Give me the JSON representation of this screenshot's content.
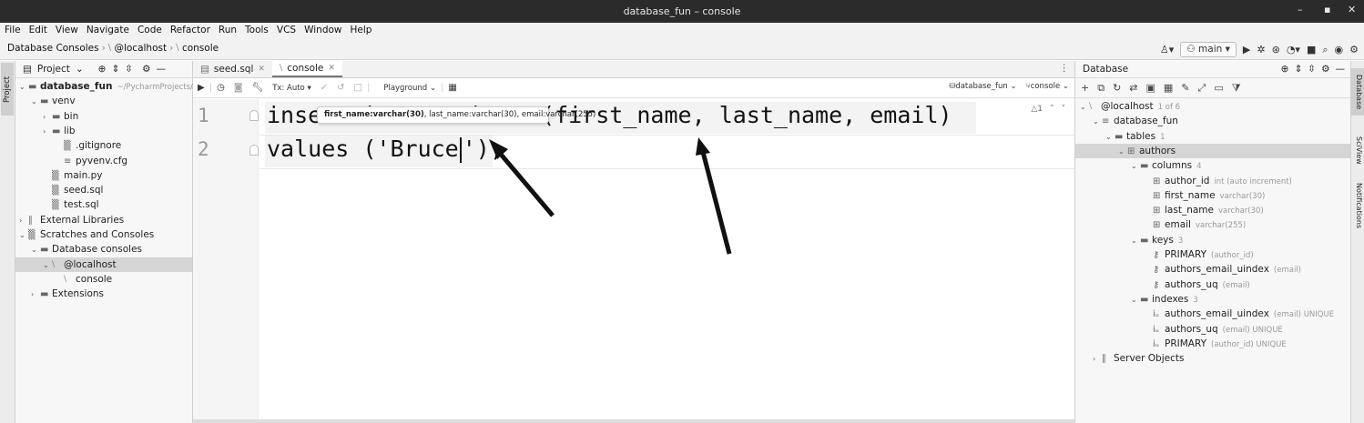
{
  "window": {
    "title": "database_fun – console",
    "min": "–",
    "restore": "▪",
    "close": "✕"
  },
  "menu": [
    "File",
    "Edit",
    "View",
    "Navigate",
    "Code",
    "Refactor",
    "Run",
    "Tools",
    "VCS",
    "Window",
    "Help"
  ],
  "breadcrumbs": [
    "Database Consoles",
    "@localhost",
    "console"
  ],
  "navbar": {
    "branch": "main"
  },
  "left_strip": {
    "project_tab": "Project"
  },
  "project_panel": {
    "title": "Project"
  },
  "project_tree": [
    {
      "label": "database_fun",
      "hint": "~/PycharmProjects/",
      "arrow": "⌄",
      "icon": "▬",
      "level": 0,
      "bold": true
    },
    {
      "label": "venv",
      "arrow": "⌄",
      "icon": "▬",
      "level": 1
    },
    {
      "label": "bin",
      "arrow": "›",
      "icon": "▬",
      "level": 2
    },
    {
      "label": "lib",
      "arrow": "›",
      "icon": "▬",
      "level": 2
    },
    {
      "label": ".gitignore",
      "arrow": "",
      "icon": "▒",
      "level": 3
    },
    {
      "label": "pyvenv.cfg",
      "arrow": "",
      "icon": "≡",
      "level": 3
    },
    {
      "label": "main.py",
      "arrow": "",
      "icon": "▒",
      "level": 2
    },
    {
      "label": "seed.sql",
      "arrow": "",
      "icon": "▒",
      "level": 2
    },
    {
      "label": "test.sql",
      "arrow": "",
      "icon": "▒",
      "level": 2
    },
    {
      "label": "External Libraries",
      "arrow": "›",
      "icon": "∥",
      "level": 0
    },
    {
      "label": "Scratches and Consoles",
      "arrow": "⌄",
      "icon": "▒",
      "level": 0
    },
    {
      "label": "Database consoles",
      "arrow": "⌄",
      "icon": "▬",
      "level": 1
    },
    {
      "label": "@localhost",
      "arrow": "⌄",
      "icon": "⧵",
      "level": 2,
      "selected": true
    },
    {
      "label": "console",
      "arrow": "",
      "icon": "⧵",
      "level": 3
    },
    {
      "label": "Extensions",
      "arrow": "›",
      "icon": "▬",
      "level": 1
    }
  ],
  "tabs": [
    {
      "label": "seed.sql",
      "close": "✕"
    },
    {
      "label": "console",
      "close": "✕"
    }
  ],
  "editor_toolbar": {
    "tx": "Tx: Auto",
    "playground": "Playground",
    "datasource": "database_fun",
    "session": "console"
  },
  "editor": {
    "line_numbers": [
      "1",
      "2"
    ],
    "line1": "insert into authors (first_name, last_name, email)",
    "line2_before_caret": "values ('Bruce",
    "line2_after_caret": "'),",
    "popup": {
      "bold": "first_name:varchar(30)",
      "rest": ", last_name:varchar(30), email:varchar(255)"
    },
    "inspection": {
      "count": "△1",
      "up": "˄",
      "down": "˅"
    }
  },
  "database_panel": {
    "title": "Database"
  },
  "db_tree": [
    {
      "label": "@localhost",
      "hint": "1 of 6",
      "arrow": "⌄",
      "icon": "⧵",
      "level": 0
    },
    {
      "label": "database_fun",
      "arrow": "⌄",
      "icon": "≡",
      "level": 1
    },
    {
      "label": "tables",
      "hint": "1",
      "arrow": "⌄",
      "icon": "▬",
      "level": 2
    },
    {
      "label": "authors",
      "arrow": "⌄",
      "icon": "⊞",
      "level": 3,
      "selected": true
    },
    {
      "label": "columns",
      "hint": "4",
      "arrow": "⌄",
      "icon": "▬",
      "level": 4
    },
    {
      "label": "author_id",
      "hint": "int (auto increment)",
      "arrow": "",
      "icon": "⊞",
      "level": 5
    },
    {
      "label": "first_name",
      "hint": "varchar(30)",
      "arrow": "",
      "icon": "⊞",
      "level": 5
    },
    {
      "label": "last_name",
      "hint": "varchar(30)",
      "arrow": "",
      "icon": "⊞",
      "level": 5
    },
    {
      "label": "email",
      "hint": "varchar(255)",
      "arrow": "",
      "icon": "⊞",
      "level": 5
    },
    {
      "label": "keys",
      "hint": "3",
      "arrow": "⌄",
      "icon": "▬",
      "level": 4
    },
    {
      "label": "PRIMARY",
      "hint": "(author_id)",
      "arrow": "",
      "icon": "⚷",
      "level": 5
    },
    {
      "label": "authors_email_uindex",
      "hint": "(email)",
      "arrow": "",
      "icon": "⚷",
      "level": 5
    },
    {
      "label": "authors_uq",
      "hint": "(email)",
      "arrow": "",
      "icon": "⚷",
      "level": 5
    },
    {
      "label": "indexes",
      "hint": "3",
      "arrow": "⌄",
      "icon": "▬",
      "level": 4
    },
    {
      "label": "authors_email_uindex",
      "hint": "(email) UNIQUE",
      "arrow": "",
      "icon": "iᵤ",
      "level": 5
    },
    {
      "label": "authors_uq",
      "hint": "(email) UNIQUE",
      "arrow": "",
      "icon": "iᵤ",
      "level": 5
    },
    {
      "label": "PRIMARY",
      "hint": "(author_id) UNIQUE",
      "arrow": "",
      "icon": "iᵤ",
      "level": 5
    },
    {
      "label": "Server Objects",
      "arrow": "›",
      "icon": "∥",
      "level": 1
    }
  ],
  "right_strip": [
    "Database",
    "SciView",
    "Notifications"
  ],
  "colors": {
    "titlebar": "#2b2b2b",
    "selection": "#d5d5d5",
    "annotation_arrow": "#111111"
  }
}
